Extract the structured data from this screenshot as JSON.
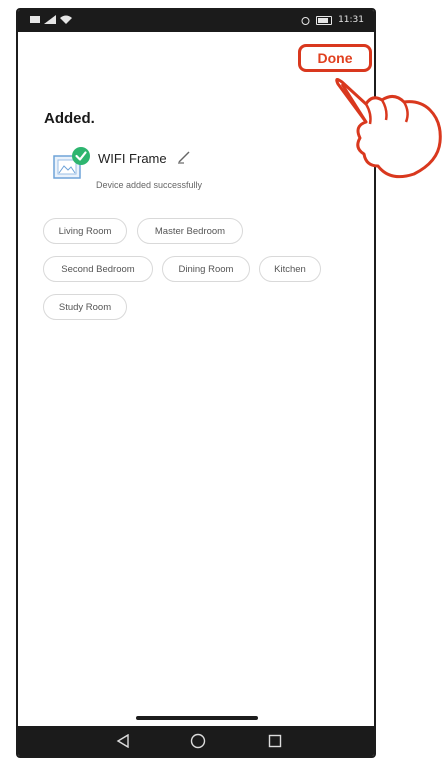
{
  "status_bar": {
    "time": "11:31"
  },
  "header": {
    "done_label": "Done"
  },
  "main": {
    "title": "Added.",
    "device": {
      "name": "WIFI Frame",
      "status": "Device added successfully"
    },
    "rooms": [
      "Living Room",
      "Master Bedroom",
      "Second Bedroom",
      "Dining Room",
      "Kitchen",
      "Study Room"
    ]
  },
  "colors": {
    "accent": "#e0401f",
    "success": "#2db56f",
    "chip_border": "#d9d9d9"
  },
  "icons": [
    "frame-icon",
    "check-icon",
    "pencil-icon",
    "back-icon",
    "home-icon",
    "recent-apps-icon",
    "pointing-hand-icon"
  ]
}
